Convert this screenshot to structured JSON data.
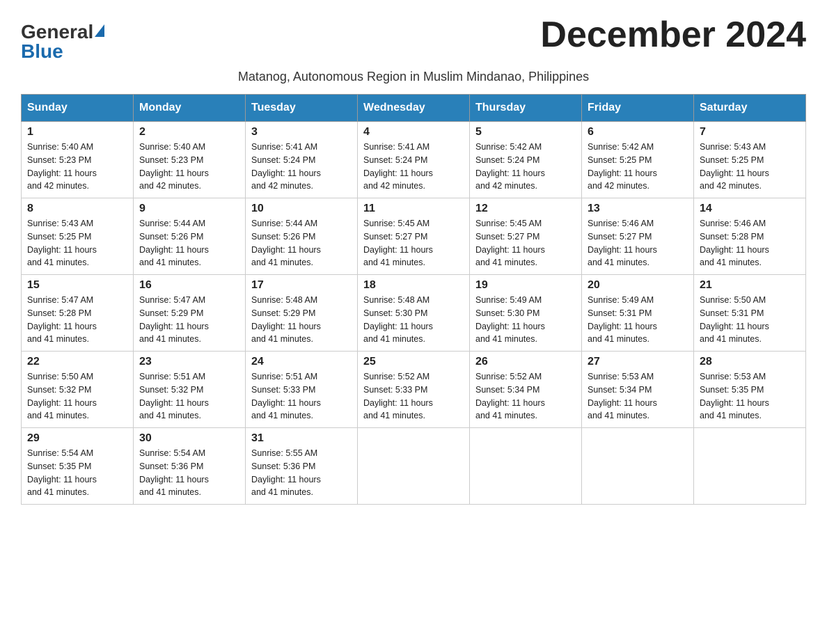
{
  "header": {
    "logo_general": "General",
    "logo_blue": "Blue",
    "month_title": "December 2024",
    "subtitle": "Matanog, Autonomous Region in Muslim Mindanao, Philippines"
  },
  "days_of_week": [
    "Sunday",
    "Monday",
    "Tuesday",
    "Wednesday",
    "Thursday",
    "Friday",
    "Saturday"
  ],
  "weeks": [
    [
      {
        "day": "1",
        "sunrise": "5:40 AM",
        "sunset": "5:23 PM",
        "daylight": "11 hours and 42 minutes."
      },
      {
        "day": "2",
        "sunrise": "5:40 AM",
        "sunset": "5:23 PM",
        "daylight": "11 hours and 42 minutes."
      },
      {
        "day": "3",
        "sunrise": "5:41 AM",
        "sunset": "5:24 PM",
        "daylight": "11 hours and 42 minutes."
      },
      {
        "day": "4",
        "sunrise": "5:41 AM",
        "sunset": "5:24 PM",
        "daylight": "11 hours and 42 minutes."
      },
      {
        "day": "5",
        "sunrise": "5:42 AM",
        "sunset": "5:24 PM",
        "daylight": "11 hours and 42 minutes."
      },
      {
        "day": "6",
        "sunrise": "5:42 AM",
        "sunset": "5:25 PM",
        "daylight": "11 hours and 42 minutes."
      },
      {
        "day": "7",
        "sunrise": "5:43 AM",
        "sunset": "5:25 PM",
        "daylight": "11 hours and 42 minutes."
      }
    ],
    [
      {
        "day": "8",
        "sunrise": "5:43 AM",
        "sunset": "5:25 PM",
        "daylight": "11 hours and 41 minutes."
      },
      {
        "day": "9",
        "sunrise": "5:44 AM",
        "sunset": "5:26 PM",
        "daylight": "11 hours and 41 minutes."
      },
      {
        "day": "10",
        "sunrise": "5:44 AM",
        "sunset": "5:26 PM",
        "daylight": "11 hours and 41 minutes."
      },
      {
        "day": "11",
        "sunrise": "5:45 AM",
        "sunset": "5:27 PM",
        "daylight": "11 hours and 41 minutes."
      },
      {
        "day": "12",
        "sunrise": "5:45 AM",
        "sunset": "5:27 PM",
        "daylight": "11 hours and 41 minutes."
      },
      {
        "day": "13",
        "sunrise": "5:46 AM",
        "sunset": "5:27 PM",
        "daylight": "11 hours and 41 minutes."
      },
      {
        "day": "14",
        "sunrise": "5:46 AM",
        "sunset": "5:28 PM",
        "daylight": "11 hours and 41 minutes."
      }
    ],
    [
      {
        "day": "15",
        "sunrise": "5:47 AM",
        "sunset": "5:28 PM",
        "daylight": "11 hours and 41 minutes."
      },
      {
        "day": "16",
        "sunrise": "5:47 AM",
        "sunset": "5:29 PM",
        "daylight": "11 hours and 41 minutes."
      },
      {
        "day": "17",
        "sunrise": "5:48 AM",
        "sunset": "5:29 PM",
        "daylight": "11 hours and 41 minutes."
      },
      {
        "day": "18",
        "sunrise": "5:48 AM",
        "sunset": "5:30 PM",
        "daylight": "11 hours and 41 minutes."
      },
      {
        "day": "19",
        "sunrise": "5:49 AM",
        "sunset": "5:30 PM",
        "daylight": "11 hours and 41 minutes."
      },
      {
        "day": "20",
        "sunrise": "5:49 AM",
        "sunset": "5:31 PM",
        "daylight": "11 hours and 41 minutes."
      },
      {
        "day": "21",
        "sunrise": "5:50 AM",
        "sunset": "5:31 PM",
        "daylight": "11 hours and 41 minutes."
      }
    ],
    [
      {
        "day": "22",
        "sunrise": "5:50 AM",
        "sunset": "5:32 PM",
        "daylight": "11 hours and 41 minutes."
      },
      {
        "day": "23",
        "sunrise": "5:51 AM",
        "sunset": "5:32 PM",
        "daylight": "11 hours and 41 minutes."
      },
      {
        "day": "24",
        "sunrise": "5:51 AM",
        "sunset": "5:33 PM",
        "daylight": "11 hours and 41 minutes."
      },
      {
        "day": "25",
        "sunrise": "5:52 AM",
        "sunset": "5:33 PM",
        "daylight": "11 hours and 41 minutes."
      },
      {
        "day": "26",
        "sunrise": "5:52 AM",
        "sunset": "5:34 PM",
        "daylight": "11 hours and 41 minutes."
      },
      {
        "day": "27",
        "sunrise": "5:53 AM",
        "sunset": "5:34 PM",
        "daylight": "11 hours and 41 minutes."
      },
      {
        "day": "28",
        "sunrise": "5:53 AM",
        "sunset": "5:35 PM",
        "daylight": "11 hours and 41 minutes."
      }
    ],
    [
      {
        "day": "29",
        "sunrise": "5:54 AM",
        "sunset": "5:35 PM",
        "daylight": "11 hours and 41 minutes."
      },
      {
        "day": "30",
        "sunrise": "5:54 AM",
        "sunset": "5:36 PM",
        "daylight": "11 hours and 41 minutes."
      },
      {
        "day": "31",
        "sunrise": "5:55 AM",
        "sunset": "5:36 PM",
        "daylight": "11 hours and 41 minutes."
      },
      null,
      null,
      null,
      null
    ]
  ],
  "labels": {
    "sunrise": "Sunrise:",
    "sunset": "Sunset:",
    "daylight": "Daylight:"
  }
}
